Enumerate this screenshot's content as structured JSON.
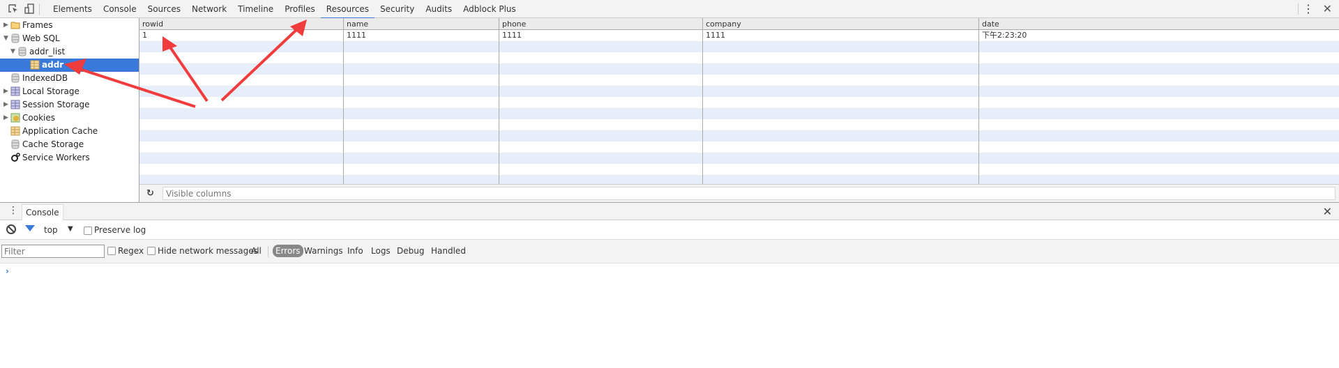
{
  "toolbar": {
    "tabs": [
      "Elements",
      "Console",
      "Sources",
      "Network",
      "Timeline",
      "Profiles",
      "Resources",
      "Security",
      "Audits",
      "Adblock Plus"
    ],
    "active_tab": "Resources"
  },
  "sidebar": {
    "items": [
      {
        "label": "Frames",
        "icon": "folder-icon",
        "expandable": true,
        "expanded": false
      },
      {
        "label": "Web SQL",
        "icon": "database-icon",
        "expandable": true,
        "expanded": true
      },
      {
        "label": "addr_list",
        "icon": "database-icon",
        "expandable": true,
        "expanded": true
      },
      {
        "label": "addr",
        "icon": "table-icon",
        "selected": true
      },
      {
        "label": "IndexedDB",
        "icon": "database-icon"
      },
      {
        "label": "Local Storage",
        "icon": "grid-icon",
        "expandable": true
      },
      {
        "label": "Session Storage",
        "icon": "grid-icon",
        "expandable": true
      },
      {
        "label": "Cookies",
        "icon": "cookie-icon",
        "expandable": true
      },
      {
        "label": "Application Cache",
        "icon": "table-icon"
      },
      {
        "label": "Cache Storage",
        "icon": "database-icon"
      },
      {
        "label": "Service Workers",
        "icon": "gears-icon"
      }
    ]
  },
  "table": {
    "columns": [
      "rowid",
      "name",
      "phone",
      "company",
      "date"
    ],
    "rows": [
      [
        "1",
        "1111",
        "1111",
        "1111",
        "下午2:23:20"
      ]
    ],
    "visible_columns_placeholder": "Visible columns"
  },
  "drawer": {
    "tab_label": "Console",
    "context": "top",
    "preserve_log_label": "Preserve log",
    "filter_placeholder": "Filter",
    "regex_label": "Regex",
    "hide_network_label": "Hide network messages",
    "levels": [
      "All",
      "Errors",
      "Warnings",
      "Info",
      "Logs",
      "Debug",
      "Handled"
    ],
    "active_level": "Errors",
    "prompt": "›"
  },
  "colors": {
    "accent": "#3879d9",
    "annotation": "#f03c3c",
    "row_stripe": "#e6eef9"
  }
}
